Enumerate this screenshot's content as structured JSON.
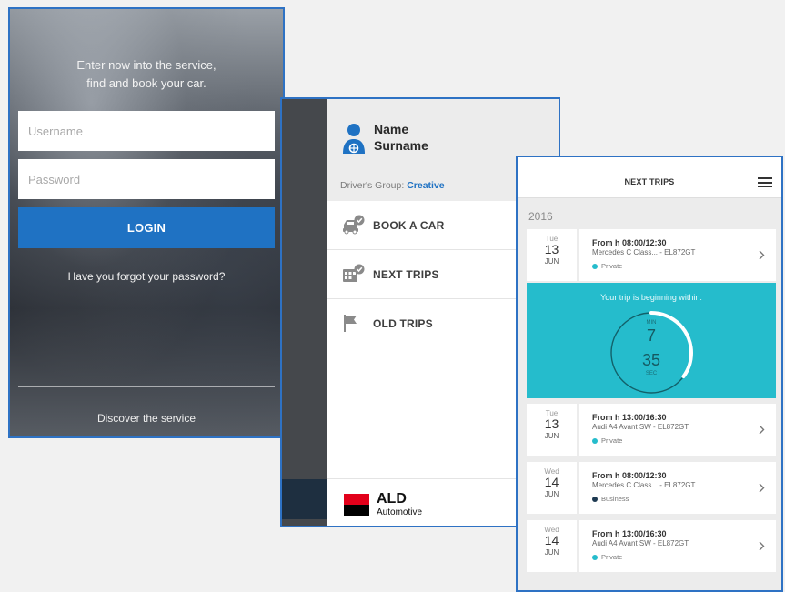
{
  "login": {
    "intro_line1": "Enter now into the service,",
    "intro_line2": "find and book your car.",
    "username_placeholder": "Username",
    "password_placeholder": "Password",
    "login_label": "LOGIN",
    "forgot_label": "Have you forgot your password?",
    "discover_label": "Discover the service"
  },
  "menu": {
    "first_name": "Name",
    "last_name": "Surname",
    "driver_group_label": "Driver's Group:",
    "driver_group_value": "Creative",
    "items": [
      {
        "label": "BOOK A CAR",
        "icon": "car-check-icon"
      },
      {
        "label": "NEXT TRIPS",
        "icon": "calendar-check-icon"
      },
      {
        "label": "OLD TRIPS",
        "icon": "flag-icon"
      }
    ],
    "brand_name": "ALD",
    "brand_sub": "Automotive"
  },
  "trips": {
    "title": "NEXT TRIPS",
    "year": "2016",
    "countdown": {
      "title": "Your trip is beginning within:",
      "min_label": "MIN",
      "minutes": "7",
      "seconds": "35",
      "sec_label": "SEC",
      "progress": 0.35
    },
    "list": [
      {
        "dow": "Tue",
        "day": "13",
        "month": "JUN",
        "time": "From h 08:00/12:30",
        "car": "Mercedes C Class... - EL872GT",
        "type": "Private"
      },
      {
        "dow": "Tue",
        "day": "13",
        "month": "JUN",
        "time": "From h 13:00/16:30",
        "car": "Audi A4 Avant SW - EL872GT",
        "type": "Private"
      },
      {
        "dow": "Wed",
        "day": "14",
        "month": "JUN",
        "time": "From h 08:00/12:30",
        "car": "Mercedes C Class... - EL872GT",
        "type": "Business"
      },
      {
        "dow": "Wed",
        "day": "14",
        "month": "JUN",
        "time": "From h 13:00/16:30",
        "car": "Audi A4 Avant SW - EL872GT",
        "type": "Private"
      }
    ]
  },
  "colors": {
    "accent_blue": "#1f72c3",
    "countdown_teal": "#25bccc",
    "private_dot": "#25bccc",
    "business_dot": "#1e3a52",
    "brand_red": "#e2001a"
  }
}
